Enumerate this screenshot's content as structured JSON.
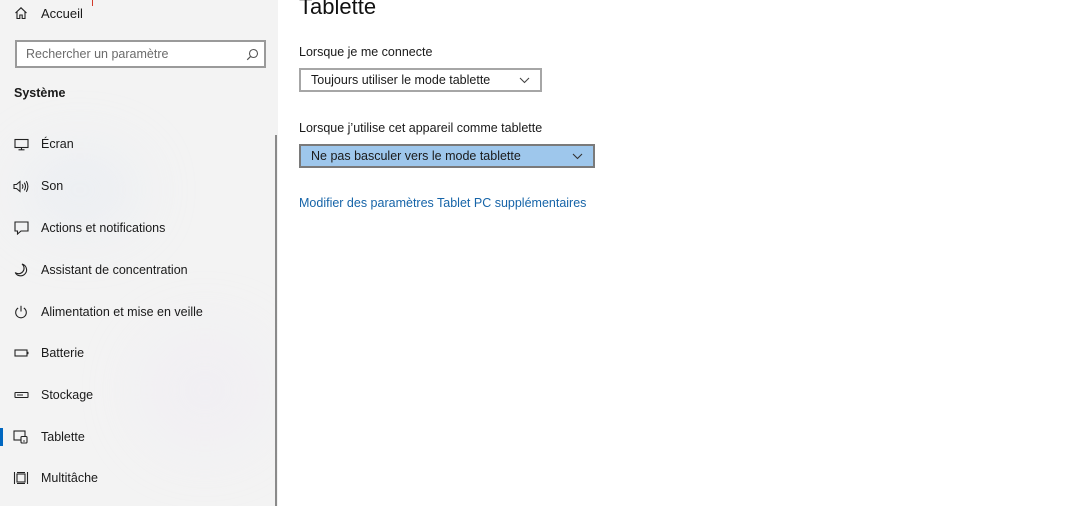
{
  "sidebar": {
    "home_label": "Accueil",
    "search_placeholder": "Rechercher un paramètre",
    "section_title": "Système",
    "items": [
      {
        "label": "Écran",
        "icon": "monitor-icon"
      },
      {
        "label": "Son",
        "icon": "speaker-icon"
      },
      {
        "label": "Actions et notifications",
        "icon": "notification-icon"
      },
      {
        "label": "Assistant de concentration",
        "icon": "moon-icon"
      },
      {
        "label": "Alimentation et mise en veille",
        "icon": "power-icon"
      },
      {
        "label": "Batterie",
        "icon": "battery-icon"
      },
      {
        "label": "Stockage",
        "icon": "storage-icon"
      },
      {
        "label": "Tablette",
        "icon": "tablet-icon",
        "selected": true
      },
      {
        "label": "Multitâche",
        "icon": "multitask-icon"
      }
    ]
  },
  "main": {
    "title": "Tablette",
    "signin_label": "Lorsque je me connecte",
    "signin_value": "Toujours utiliser le mode tablette",
    "tablet_label": "Lorsque j’utilise cet appareil comme tablette",
    "tablet_value": "Ne pas basculer vers le mode tablette",
    "link": "Modifier des paramètres Tablet PC supplémentaires"
  },
  "colors": {
    "accent": "#0067c0",
    "link": "#1664a8",
    "dropdown_focus_bg": "#9ec7ec",
    "sidebar_bg": "#f3f3f3"
  }
}
